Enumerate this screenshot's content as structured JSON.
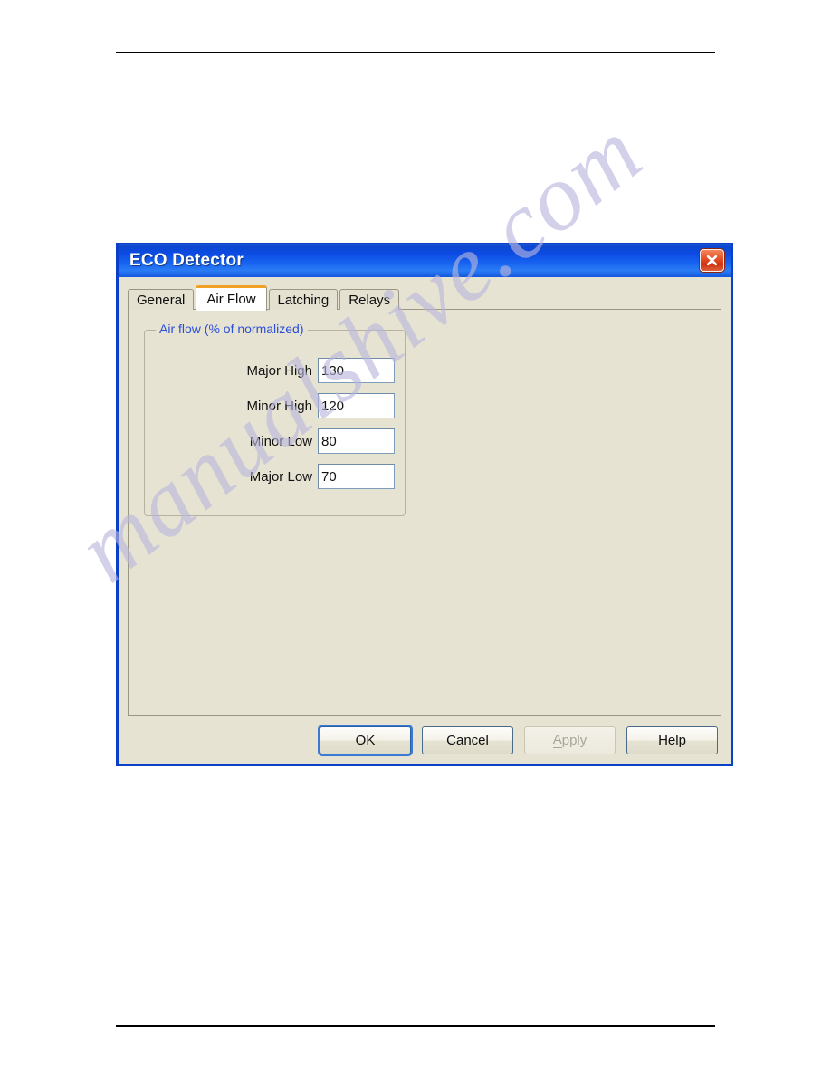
{
  "page": {
    "background": "#ffffff",
    "rules": {
      "color": "#000000"
    },
    "watermark": {
      "text": "manualshive.com",
      "color": "#b9b6dd"
    }
  },
  "dialog": {
    "title": "ECO Detector",
    "titlebar_color": "#0c4ae2",
    "face_color": "#e6e3d3",
    "border_color": "#0a3fc8",
    "close_icon": "close-icon",
    "close_color": "#cf3110"
  },
  "tabs": [
    {
      "label": "General",
      "active": false
    },
    {
      "label": "Air Flow",
      "active": true
    },
    {
      "label": "Latching",
      "active": false
    },
    {
      "label": "Relays",
      "active": false
    }
  ],
  "group": {
    "legend": "Air flow (% of normalized)",
    "legend_color": "#2b4fd6",
    "fields": [
      {
        "label": "Major High",
        "value": "130"
      },
      {
        "label": "Minor High",
        "value": "120"
      },
      {
        "label": "Minor Low",
        "value": "80"
      },
      {
        "label": "Major Low",
        "value": "70"
      }
    ]
  },
  "buttons": [
    {
      "label": "OK",
      "state": "default"
    },
    {
      "label": "Cancel",
      "state": "normal"
    },
    {
      "label": "Apply",
      "state": "disabled",
      "accel": "A",
      "rest": "pply"
    },
    {
      "label": "Help",
      "state": "normal"
    }
  ]
}
